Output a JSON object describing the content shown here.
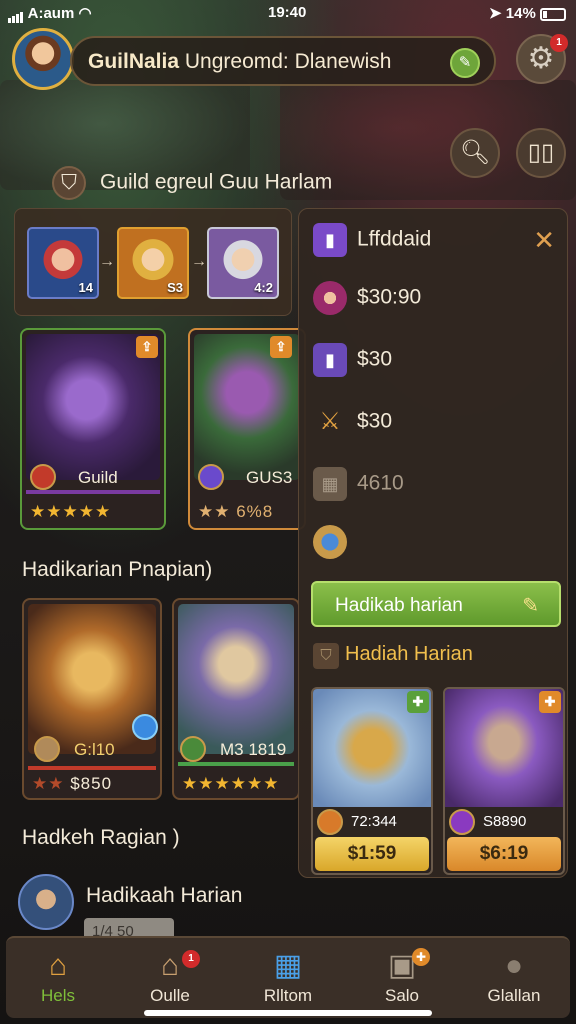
{
  "status": {
    "carrier": "A:aum",
    "time": "19:40",
    "battery": "14%"
  },
  "header": {
    "title_bold": "GuilNalia",
    "title_rest": "Ungreomd: Dlanewish"
  },
  "guild": {
    "heading": "Guild egreul Guu Harlam",
    "upgrade_portraits": [
      "14",
      "S3",
      "4:2"
    ]
  },
  "hero_cards_top": [
    {
      "name": "Guild",
      "stars": "★★★★★"
    },
    {
      "name": "GUS3",
      "stars": "★★ 6%8"
    }
  ],
  "section1": "Hadikarian Pnapian)",
  "hero_cards_mid": [
    {
      "name": "G:l10",
      "price": "$850",
      "stars": "★★"
    },
    {
      "name": "M3 1819",
      "stars": "★★★★★★"
    }
  ],
  "section2": "Hadkeh Ragian )",
  "bottom_row": {
    "label": "Hadikaah Harian",
    "input": "1/4 50"
  },
  "panel": {
    "title": "Lffddaid",
    "rows": [
      "$30:90",
      "$30",
      "$30",
      "4610"
    ],
    "button": "Hadikab harian",
    "gold_title": "Hadiah Harian",
    "shop": [
      {
        "caption": "72:344",
        "price": "$1:59"
      },
      {
        "caption": "S8890",
        "price": "$6:19"
      }
    ]
  },
  "badges": {
    "gear": "1",
    "tab2": "1"
  },
  "tabs": [
    "Hels",
    "Oulle",
    "Rlltom",
    "Salo",
    "Glallan"
  ],
  "colors": {
    "accent_green": "#7fbf3a",
    "gold": "#f1bf4d",
    "panel": "#302620"
  }
}
